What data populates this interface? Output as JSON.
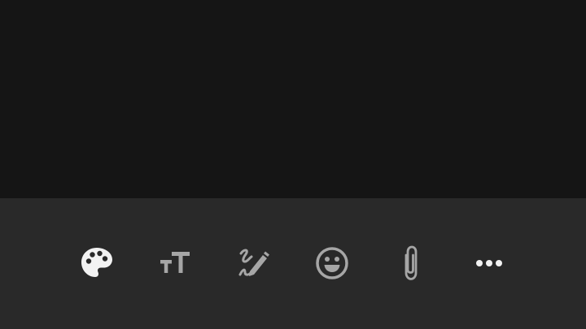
{
  "colors": {
    "background": "#151515",
    "toolbar": "#292929",
    "active_icon": "#f2f2f2",
    "inactive_icon": "#a6a6a6"
  },
  "toolbar": {
    "items": [
      {
        "icon": "palette-icon",
        "state": "active"
      },
      {
        "icon": "text-size-icon",
        "state": "inactive"
      },
      {
        "icon": "pencil-scribble-icon",
        "state": "inactive"
      },
      {
        "icon": "emoji-icon",
        "state": "inactive"
      },
      {
        "icon": "paperclip-icon",
        "state": "inactive"
      },
      {
        "icon": "more-icon",
        "state": "inactive"
      }
    ]
  }
}
